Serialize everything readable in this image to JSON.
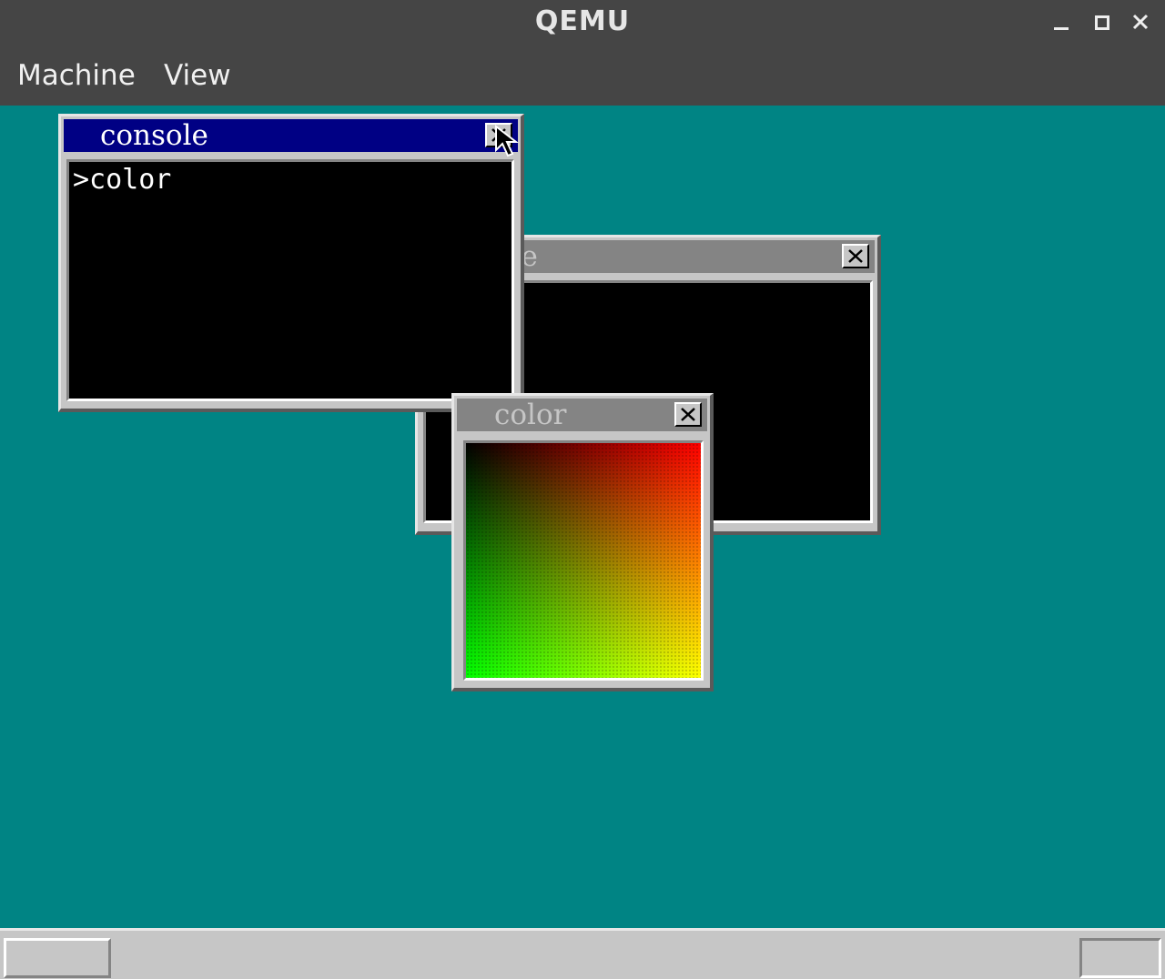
{
  "app": {
    "title": "QEMU"
  },
  "window_controls": {
    "minimize": "minimize-icon",
    "maximize": "maximize-icon",
    "close": "close-icon"
  },
  "menubar": {
    "items": [
      {
        "label": "Machine"
      },
      {
        "label": "View"
      }
    ]
  },
  "desktop": {
    "background": "#008484",
    "windows": [
      {
        "title": "console",
        "active": true,
        "lines": [
          ">color"
        ]
      },
      {
        "title": "console",
        "active": false,
        "visible_title_fragment": "ole"
      },
      {
        "title": "color",
        "active": false,
        "gradient": {
          "top_left": "#000000",
          "top_right": "#ff0000",
          "bottom_left": "#00ff00",
          "bottom_right": "#ffff00"
        }
      }
    ]
  },
  "colors": {
    "active_titlebar": "#000084",
    "inactive_titlebar": "#848484",
    "window_face": "#c6c6c6"
  }
}
